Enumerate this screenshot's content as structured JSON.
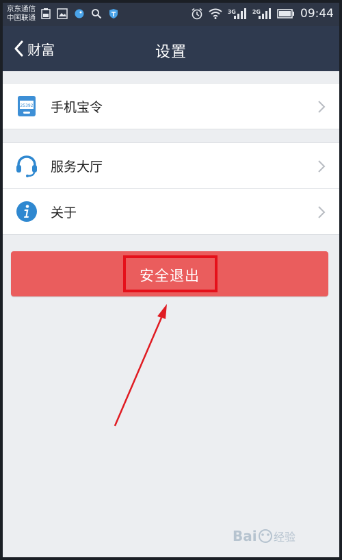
{
  "status_bar": {
    "carrier_line1": "京东通信",
    "carrier_line2": "中国联通",
    "network_tag_1": "3G",
    "network_tag_2": "2G",
    "time": "09:44"
  },
  "header": {
    "back_label": "财富",
    "title": "设置"
  },
  "group1": {
    "items": [
      {
        "label": "手机宝令",
        "icon": "token-device-icon"
      }
    ]
  },
  "group2": {
    "items": [
      {
        "label": "服务大厅",
        "icon": "headset-icon"
      },
      {
        "label": "关于",
        "icon": "info-icon"
      }
    ]
  },
  "logout": {
    "label": "安全退出"
  },
  "colors": {
    "status_bar": "#2e3646",
    "title_bar": "#2f3a4f",
    "logout": "#ea5d5d",
    "highlight": "#e5101a",
    "accent_blue": "#2f88d0"
  }
}
